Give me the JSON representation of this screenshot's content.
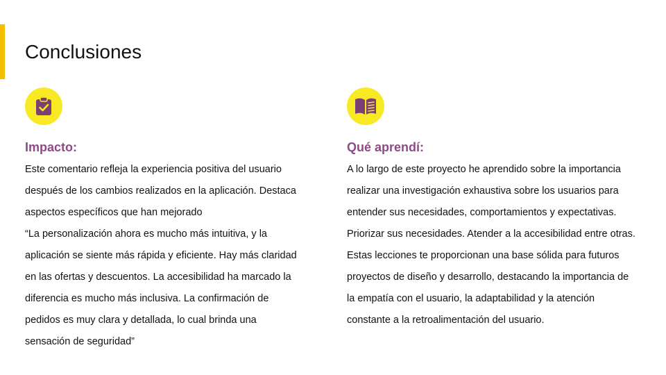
{
  "slide": {
    "title": "Conclusiones",
    "accent_color": "#f5be00"
  },
  "columns": {
    "left": {
      "icon": "clipboard-check-icon",
      "heading": "Impacto:",
      "body": "Este comentario refleja la experiencia positiva del usuario\ndespués de los cambios realizados en la aplicación. Destaca\naspectos específicos que han mejorado\n“La personalización ahora es mucho más intuitiva, y la\naplicación se siente más rápida y eficiente. Hay más claridad\nen las ofertas y descuentos. La accesibilidad ha marcado la\ndiferencia es mucho más inclusiva. La confirmación de\npedidos es muy clara y detallada, lo cual brinda una\nsensación de seguridad”"
    },
    "right": {
      "icon": "open-book-icon",
      "heading": "Qué aprendí:",
      "body": "A lo largo de este proyecto he aprendido sobre la importancia\nrealizar una investigación exhaustiva sobre los usuarios para\nentender sus necesidades, comportamientos y expectativas.\nPriorizar sus necesidades. Atender a la accesibilidad entre otras.\n Estas lecciones te proporcionan una base sólida para futuros\nproyectos de diseño y desarrollo, destacando la importancia de\nla empatía con el usuario, la adaptabilidad y la atención\nconstante a la retroalimentación del usuario."
    }
  },
  "colors": {
    "heading": "#8d4a86",
    "icon_fill": "#7b3f73",
    "icon_bg": "#f7ea24"
  }
}
